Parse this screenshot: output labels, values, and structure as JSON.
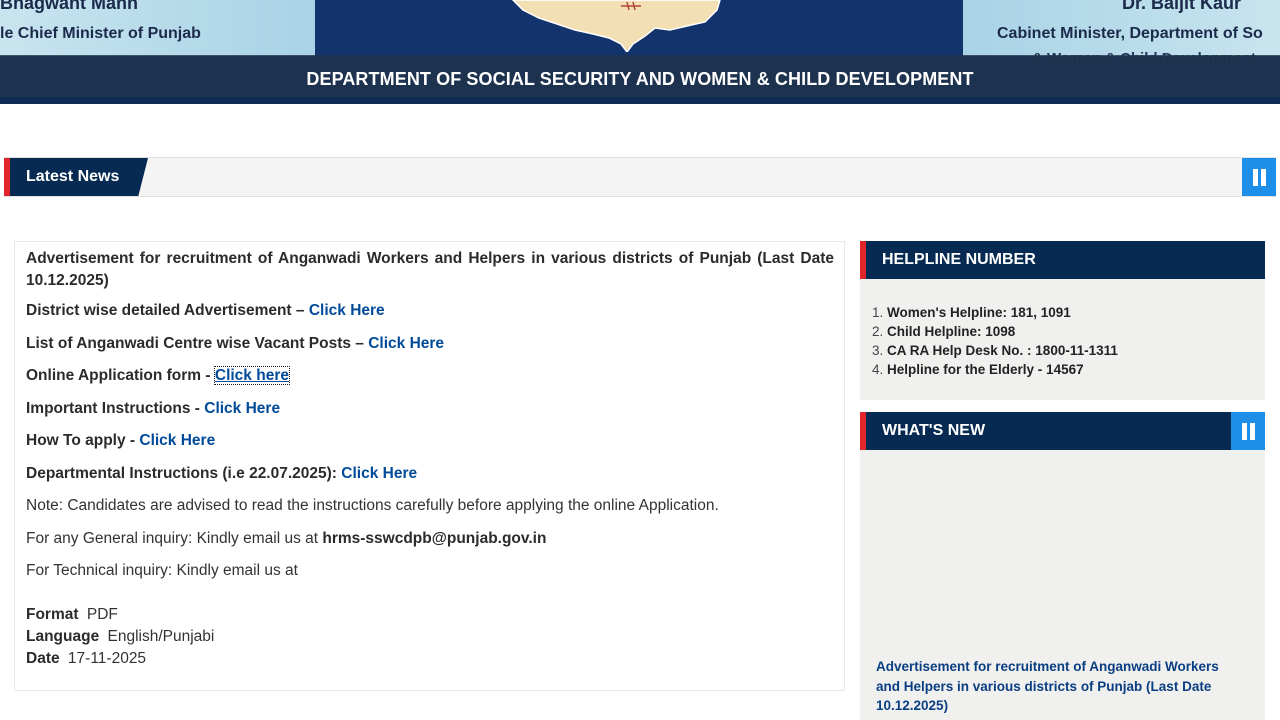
{
  "banner": {
    "left_name": "Bhagwant Mann",
    "left_title": "le Chief Minister of Punjab",
    "right_name": "Dr. Baljit Kaur",
    "right_title_line1": "Cabinet Minister, Department of So",
    "right_title_line2": "& Women & Child Development",
    "department_title": "DEPARTMENT OF SOCIAL SECURITY AND WOMEN & CHILD DEVELOPMENT"
  },
  "ticker": {
    "label": "Latest News"
  },
  "content": {
    "ad_title": "Advertisement for recruitment of Anganwadi Workers and Helpers in various districts of Punjab (Last Date 10.12.2025)",
    "items": [
      {
        "label": "District wise detailed Advertisement – ",
        "link": "Click Here"
      },
      {
        "label": "List of Anganwadi Centre wise Vacant Posts – ",
        "link": "Click Here"
      },
      {
        "label": "Online Application form - ",
        "link": "Click here"
      },
      {
        "label": "Important Instructions - ",
        "link": "Click Here"
      },
      {
        "label": "How To apply - ",
        "link": "Click Here"
      },
      {
        "label": "Departmental Instructions (i.e 22.07.2025): ",
        "link": "Click Here"
      }
    ],
    "note": "Note: Candidates are advised to read the instructions carefully before applying the online Application.",
    "general_inquiry_text": "For any General inquiry: Kindly email us at ",
    "general_inquiry_email": "hrms-sswcdpb@punjab.gov.in",
    "technical_inquiry_text": "For Technical inquiry:  Kindly email us at",
    "meta": {
      "format_label": "Format",
      "format_value": "PDF",
      "language_label": "Language",
      "language_value": "English/Punjabi",
      "date_label": "Date",
      "date_value": "17-11-2025"
    }
  },
  "sidebar": {
    "helpline_title": "HELPLINE NUMBER",
    "helplines": [
      {
        "num": "1.",
        "text": "Women's Helpline: 181, 1091"
      },
      {
        "num": "2.",
        "text": "Child Helpline: 1098"
      },
      {
        "num": "3.",
        "text": "CA RA Help Desk No. : 1800-11-1311"
      },
      {
        "num": "4.",
        "text": "Helpline for the Elderly - 14567"
      }
    ],
    "whats_new_title": "WHAT'S NEW",
    "whats_new_item": "Advertisement for recruitment of Anganwadi Workers and Helpers in various districts of Punjab (Last Date 10.12.2025)"
  },
  "colors": {
    "navy": "#062a51",
    "accent_red": "#e0262b",
    "link_blue": "#004a99",
    "pause_blue": "#1e8fe8"
  },
  "icons": {
    "ticker_pause": "pause-icon",
    "whats_new_pause": "pause-icon",
    "map": "punjab-map-icon"
  }
}
